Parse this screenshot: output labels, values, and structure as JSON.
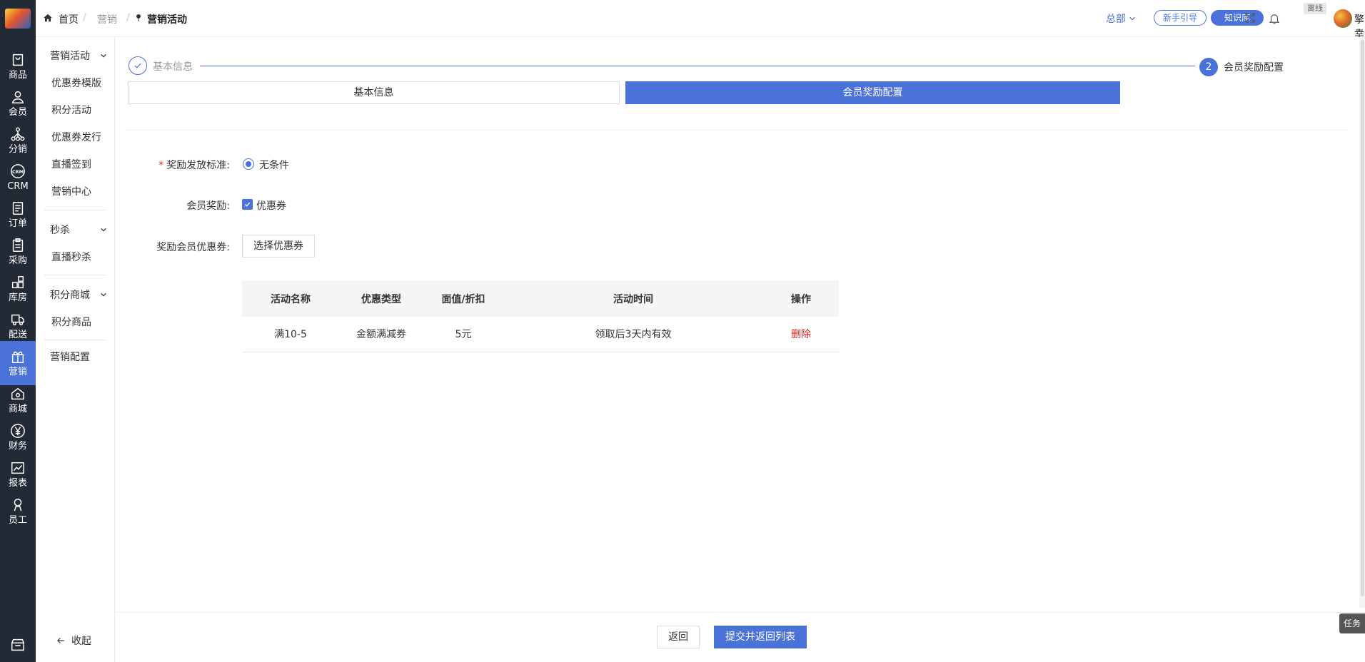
{
  "colors": {
    "primary": "#4a72d8",
    "rail_bg": "#222a36",
    "danger": "#e02020"
  },
  "rail": [
    {
      "label": "商品",
      "icon": "bag-icon"
    },
    {
      "label": "会员",
      "icon": "user-icon"
    },
    {
      "label": "分销",
      "icon": "share-tree-icon"
    },
    {
      "label": "CRM",
      "icon": "crm-icon"
    },
    {
      "label": "订单",
      "icon": "order-icon"
    },
    {
      "label": "采购",
      "icon": "clipboard-icon"
    },
    {
      "label": "库房",
      "icon": "warehouse-icon"
    },
    {
      "label": "配送",
      "icon": "truck-icon"
    },
    {
      "label": "营销",
      "icon": "gift-icon"
    },
    {
      "label": "商城",
      "icon": "shop-icon"
    },
    {
      "label": "财务",
      "icon": "yen-icon"
    },
    {
      "label": "报表",
      "icon": "chart-icon"
    },
    {
      "label": "员工",
      "icon": "staff-icon"
    },
    {
      "label": "",
      "icon": "store-icon"
    }
  ],
  "submenu": {
    "group_marketing": "营销活动",
    "items_marketing": [
      "优惠券模版",
      "积分活动",
      "优惠券发行",
      "直播签到",
      "营销中心"
    ],
    "group_seckill": "秒杀",
    "items_seckill": [
      "直播秒杀"
    ],
    "group_points": "积分商城",
    "items_points": [
      "积分商品"
    ],
    "config": "营销配置",
    "collapse": "收起"
  },
  "header": {
    "home": "首页",
    "crumb_marketing": "营销",
    "crumb_sep": "/",
    "current": "营销活动",
    "hq": "总部",
    "guide": "新手引导",
    "kb": "知识库",
    "offline": "离线",
    "username": "擎幸"
  },
  "steps": {
    "step1": "基本信息",
    "step2_num": "2",
    "step2": "会员奖励配置"
  },
  "tabs": {
    "basic": "基本信息",
    "reward": "会员奖励配置"
  },
  "form": {
    "standard_label": "奖励发放标准:",
    "standard_value": "无条件",
    "reward_label": "会员奖励:",
    "reward_value": "优惠券",
    "coupon_label": "奖励会员优惠券:",
    "select_button": "选择优惠券"
  },
  "table": {
    "headers": [
      "活动名称",
      "优惠类型",
      "面值/折扣",
      "活动时间",
      "操作"
    ],
    "rows": [
      {
        "name": "满10-5",
        "type": "金额满减券",
        "value": "5元",
        "time": "领取后3天内有效",
        "action": "删除"
      }
    ]
  },
  "footer": {
    "back": "返回",
    "submit": "提交并返回列表"
  },
  "task": "任务"
}
